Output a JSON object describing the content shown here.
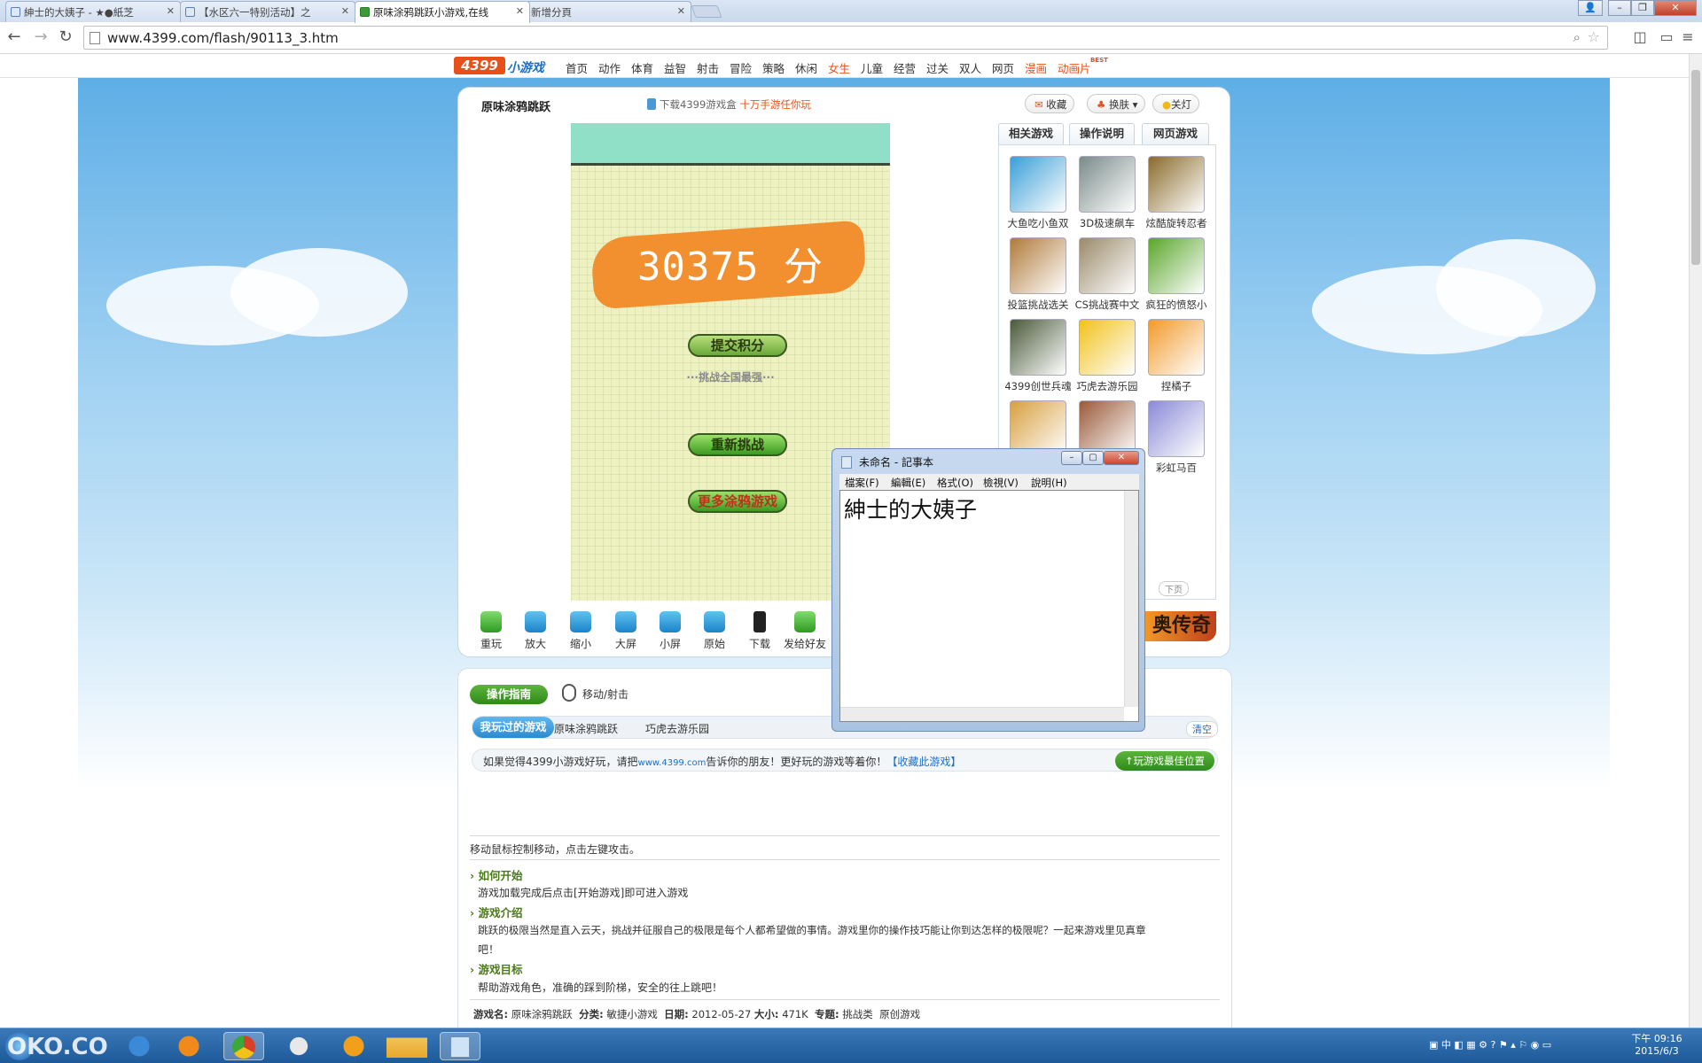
{
  "browser": {
    "tabs": [
      {
        "label": "紳士的大姨子 - ★●紙芝"
      },
      {
        "label": "【水区六一特别活动】之"
      },
      {
        "label": "原味涂鸦跳跃小游戏,在线"
      },
      {
        "label": "新增分頁"
      }
    ],
    "url": "www.4399.com/flash/90113_3.htm"
  },
  "site": {
    "logo_num": "4399",
    "logo_text": "小游戏",
    "nav": [
      "首页",
      "动作",
      "体育",
      "益智",
      "射击",
      "冒险",
      "策略",
      "休闲",
      "女生",
      "儿童",
      "经营",
      "过关",
      "双人",
      "网页",
      "漫画",
      "动画片"
    ],
    "nav_badge": "BEST"
  },
  "game": {
    "title": "原味涂鸦跳跃",
    "promo_prefix": "下载4399游戏盒",
    "promo_highlight": "十万手游任你玩",
    "btn_collect": "收藏",
    "btn_skin": "换肤",
    "btn_light": "关灯",
    "score": "30375 分",
    "submit": "提交积分",
    "challenge": "···挑战全国最强···",
    "retry": "重新挑战",
    "more": "更多涂鸦游戏"
  },
  "side_tabs": [
    "相关游戏",
    "操作说明",
    "网页游戏"
  ],
  "related": [
    {
      "name": "大鱼吃小鱼双",
      "color": "#3a9fd8"
    },
    {
      "name": "3D极速飙车",
      "color": "#7a8b8a"
    },
    {
      "name": "炫酷旋转忍者",
      "color": "#8a6a2a"
    },
    {
      "name": "投篮挑战选关",
      "color": "#b07a3a"
    },
    {
      "name": "CS挑战赛中文",
      "color": "#9a8a6a"
    },
    {
      "name": "疯狂的愤怒小",
      "color": "#5aa62a"
    },
    {
      "name": "4399创世兵魂",
      "color": "#4a5a3a"
    },
    {
      "name": "巧虎去游乐园",
      "color": "#f2c21a"
    },
    {
      "name": "捏橘子",
      "color": "#f29a2a"
    },
    {
      "name": "",
      "color": "#d8a040"
    },
    {
      "name": "",
      "color": "#9a5a3a"
    },
    {
      "name": "彩虹马百",
      "color": "#8a8ad8"
    }
  ],
  "side_next": "下页",
  "side_banner": "奥传奇",
  "controls": [
    "重玩",
    "放大",
    "缩小",
    "大屏",
    "小屏",
    "原始",
    "下载",
    "发给好友"
  ],
  "lower": {
    "guide": "操作指南",
    "guide_action": "移动/射击",
    "played": "我玩过的游戏",
    "played_items": [
      "原味涂鸦跳跃",
      "巧虎去游乐园"
    ],
    "clear": "清空",
    "share_text": "如果觉得4399小游戏好玩，请把",
    "share_url": "www.4399.com",
    "share_text2": "告诉你的朋友！更好玩的游戏等着你！",
    "share_link": "【收藏此游戏】",
    "best_pos": "玩游戏最佳位置",
    "desc_top": "移动鼠标控制移动，点击左键攻击。",
    "sec1_h": "如何开始",
    "sec1": "游戏加载完成后点击[开始游戏]即可进入游戏",
    "sec2_h": "游戏介绍",
    "sec2a": "跳跃的极限当然是直入云天，挑战并征服自己的极限是每个人都希望做的事情。游戏里你的操作技巧能让你到达怎样的极限呢？一起来游戏里见真章",
    "sec2b": "吧！",
    "sec3_h": "游戏目标",
    "sec3": "帮助游戏角色，准确的踩到阶梯，安全的往上跳吧！",
    "meta_name_l": "游戏名:",
    "meta_name": "原味涂鸦跳跃",
    "meta_cat_l": "分类:",
    "meta_cat": "敏捷小游戏",
    "meta_date_l": "日期:",
    "meta_date": "2012-05-27",
    "meta_size_l": "大小:",
    "meta_size": "471K",
    "meta_topic_l": "专题:",
    "meta_topic": "挑战类",
    "meta_topic2": "原创游戏"
  },
  "notepad": {
    "title": "未命名 - 記事本",
    "menu": [
      "檔案(F)",
      "編輯(E)",
      "格式(O)",
      "檢視(V)",
      "說明(H)"
    ],
    "content": "紳士的大姨子"
  },
  "taskbar": {
    "watermark": "OKO.CO",
    "lang": "中",
    "time": "下午 09:16",
    "date": "2015/6/3"
  }
}
